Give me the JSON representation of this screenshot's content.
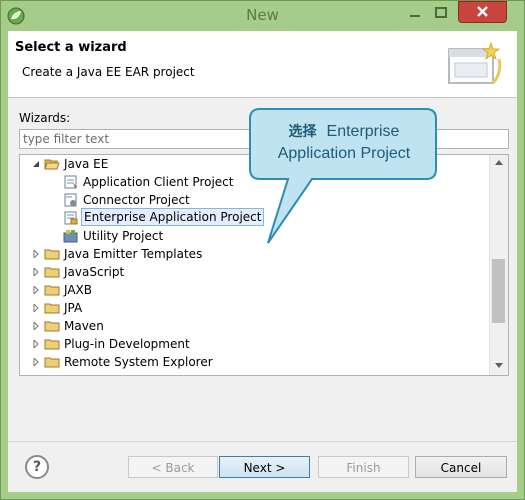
{
  "window": {
    "title": "New"
  },
  "header": {
    "title": "Select a wizard",
    "description": "Create a Java EE EAR project"
  },
  "wizards": {
    "label": "Wizards:",
    "filter_placeholder": "type filter text"
  },
  "tree": [
    {
      "label": "Java EE",
      "icon": "folder-open-icon",
      "expanded": true,
      "level": 0
    },
    {
      "label": "Application Client Project",
      "icon": "app-client-icon",
      "level": 1
    },
    {
      "label": "Connector Project",
      "icon": "connector-icon",
      "level": 1
    },
    {
      "label": "Enterprise Application Project",
      "icon": "ear-project-icon",
      "level": 1,
      "selected": true
    },
    {
      "label": "Utility Project",
      "icon": "utility-project-icon",
      "level": 1
    },
    {
      "label": "Java Emitter Templates",
      "icon": "folder-icon",
      "level": 0
    },
    {
      "label": "JavaScript",
      "icon": "folder-icon",
      "level": 0
    },
    {
      "label": "JAXB",
      "icon": "folder-icon",
      "level": 0
    },
    {
      "label": "JPA",
      "icon": "folder-icon",
      "level": 0
    },
    {
      "label": "Maven",
      "icon": "folder-icon",
      "level": 0
    },
    {
      "label": "Plug-in Development",
      "icon": "folder-icon",
      "level": 0
    },
    {
      "label": "Remote System Explorer",
      "icon": "folder-icon",
      "level": 0
    }
  ],
  "callout": {
    "zh": "选择",
    "en": "Enterprise Application Project"
  },
  "buttons": {
    "help": "?",
    "back": "< Back",
    "next": "Next >",
    "finish": "Finish",
    "cancel": "Cancel"
  },
  "colors": {
    "window_frame": "#a6cc89",
    "close_button": "#c7453d",
    "selection": "#e3efff",
    "callout_fill": "#bfe3f0"
  }
}
